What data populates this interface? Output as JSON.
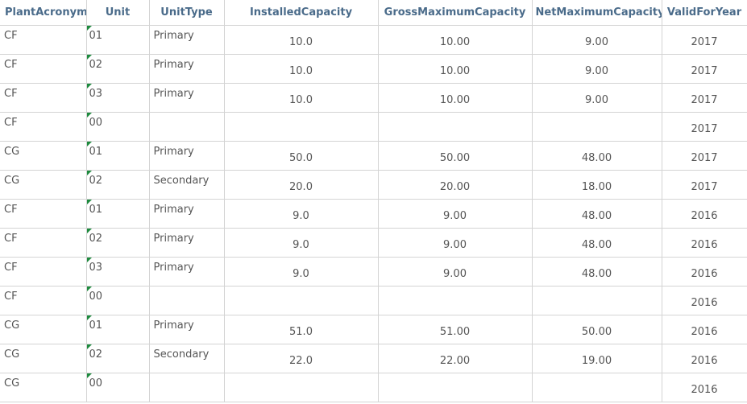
{
  "columns": [
    "PlantAcronym",
    "Unit",
    "UnitType",
    "InstalledCapacity",
    "GrossMaximumCapacity",
    "NetMaximumCapacity",
    "ValidForYear"
  ],
  "rows": [
    [
      "CF",
      "01",
      "Primary",
      "10.0",
      "10.00",
      "9.00",
      "2017"
    ],
    [
      "CF",
      "02",
      "Primary",
      "10.0",
      "10.00",
      "9.00",
      "2017"
    ],
    [
      "CF",
      "03",
      "Primary",
      "10.0",
      "10.00",
      "9.00",
      "2017"
    ],
    [
      "CF",
      "00",
      "",
      "",
      "",
      "",
      "2017"
    ],
    [
      "CG",
      "01",
      "Primary",
      "50.0",
      "50.00",
      "48.00",
      "2017"
    ],
    [
      "CG",
      "02",
      "Secondary",
      "20.0",
      "20.00",
      "18.00",
      "2017"
    ],
    [
      "CF",
      "01",
      "Primary",
      "9.0",
      "9.00",
      "48.00",
      "2016"
    ],
    [
      "CF",
      "02",
      "Primary",
      "9.0",
      "9.00",
      "48.00",
      "2016"
    ],
    [
      "CF",
      "03",
      "Primary",
      "9.0",
      "9.00",
      "48.00",
      "2016"
    ],
    [
      "CF",
      "00",
      "",
      "",
      "",
      "",
      "2016"
    ],
    [
      "CG",
      "01",
      "Primary",
      "51.0",
      "51.00",
      "50.00",
      "2016"
    ],
    [
      "CG",
      "02",
      "Secondary",
      "22.0",
      "22.00",
      "19.00",
      "2016"
    ],
    [
      "CG",
      "00",
      "",
      "",
      "",
      "",
      "2016"
    ]
  ],
  "colors": {
    "header_text": "#4a6b8a",
    "cell_text": "#555555",
    "gridline": "#d4d4d4",
    "error_flag": "#1e8a3e"
  }
}
